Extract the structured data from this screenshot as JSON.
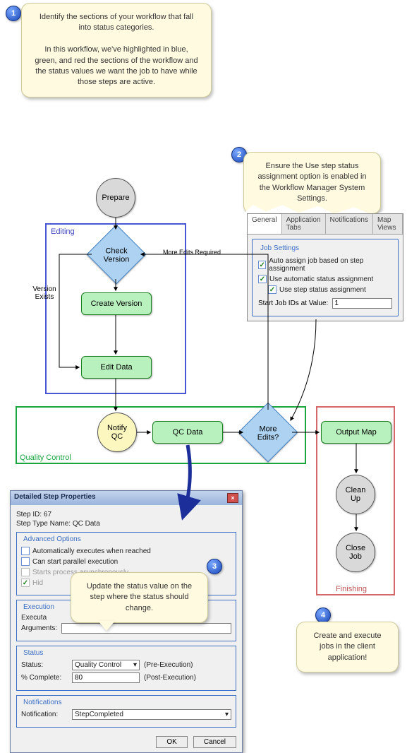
{
  "callouts": {
    "c1": {
      "num": "1",
      "p1": "Identify the sections of your workflow that fall into status categories.",
      "p2": "In this workflow, we've highlighted in blue, green, and red the sections of the workflow and the status values we want the job to have while those steps are active."
    },
    "c2": {
      "num": "2",
      "text": "Ensure the Use step status assignment option is enabled in the Workflow Manager System Settings."
    },
    "c3": {
      "num": "3",
      "text": "Update the status value on the step where the status should change."
    },
    "c4": {
      "num": "4",
      "text": "Create and execute jobs in the client application!"
    }
  },
  "flow": {
    "prepare": "Prepare",
    "check_version": "Check\nVersion",
    "create_version": "Create Version",
    "edit_data": "Edit Data",
    "version_exists": "Version\nExists",
    "more_edits_required": "More Edits Required",
    "editing": "Editing",
    "notify_qc": "Notify\nQC",
    "qc_data": "QC Data",
    "more_edits": "More\nEdits?",
    "quality_control": "Quality Control",
    "output_map": "Output Map",
    "clean_up": "Clean\nUp",
    "close_job": "Close\nJob",
    "finishing": "Finishing"
  },
  "settings": {
    "tabs": [
      "General",
      "Application Tabs",
      "Notifications",
      "Map Views"
    ],
    "group_title": "Job Settings",
    "opt1": "Auto assign job based on step assignment",
    "opt2": "Use automatic status assignment",
    "opt3": "Use step status assignment",
    "start_label": "Start Job IDs at Value:",
    "start_value": "1"
  },
  "dialog": {
    "title": "Detailed Step Properties",
    "step_id_label": "Step ID:",
    "step_id_value": "67",
    "step_type_label": "Step Type Name:",
    "step_type_value": "QC Data",
    "adv_title": "Advanced Options",
    "adv_opt1": "Automatically executes when reached",
    "adv_opt2": "Can start parallel execution",
    "adv_opt3": "Starts process asynchronously",
    "adv_opt4": "Hid",
    "exec_title": "Execution",
    "exec_label": "Executa",
    "args_label": "Arguments:",
    "status_title": "Status",
    "status_label": "Status:",
    "status_value": "Quality Control",
    "status_suffix": "(Pre-Execution)",
    "complete_label": "% Complete:",
    "complete_value": "80",
    "complete_suffix": "(Post-Execution)",
    "notif_title": "Notifications",
    "notif_label": "Notification:",
    "notif_value": "StepCompleted",
    "ok": "OK",
    "cancel": "Cancel"
  }
}
